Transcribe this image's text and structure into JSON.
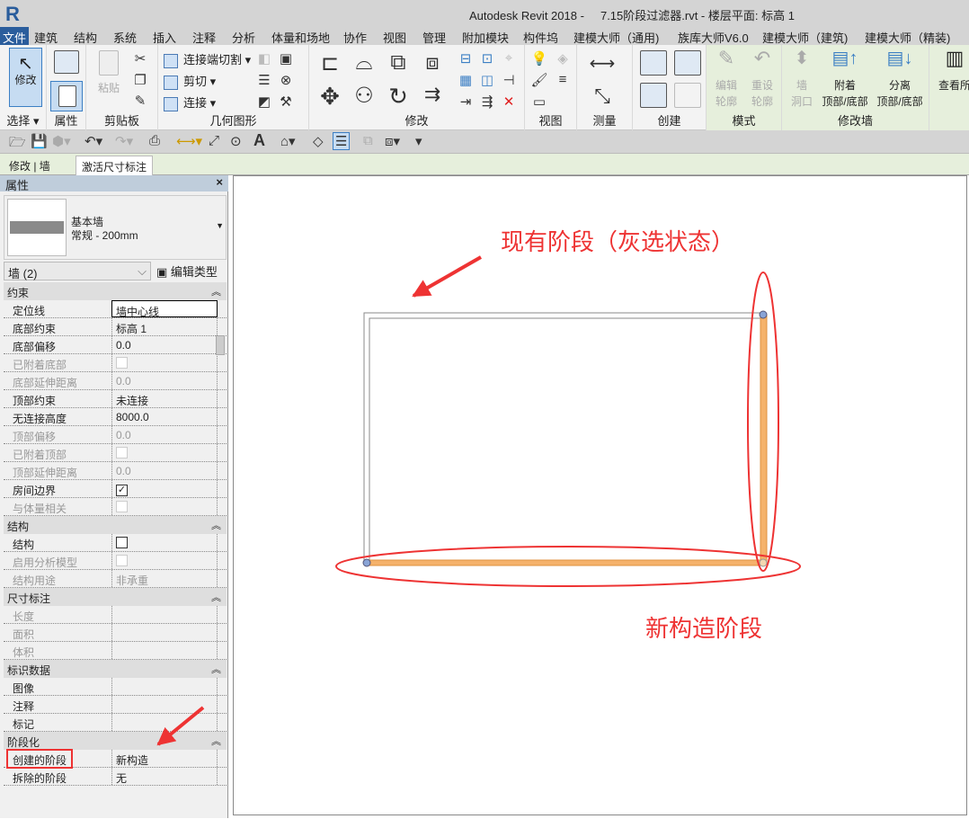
{
  "app": {
    "logo": "R",
    "title": "Autodesk Revit 2018 -     7.15阶段过滤器.rvt - 楼层平面: 标高 1"
  },
  "tabs": [
    "文件",
    "建筑",
    "结构",
    "系统",
    "插入",
    "注释",
    "分析",
    "体量和场地",
    "协作",
    "视图",
    "管理",
    "附加模块",
    "构件坞",
    "建模大师（通用)",
    "族库大师V6.0",
    "建模大师（建筑)",
    "建模大师（精装)"
  ],
  "ribbon": {
    "panels": [
      "选择",
      "属性",
      "剪贴板",
      "几何图形",
      "修改",
      "视图",
      "测量",
      "创建",
      "模式",
      "修改墙"
    ],
    "modify": "修改",
    "paste": "粘贴",
    "geometry": [
      "连接端切割",
      "剪切",
      "连接"
    ],
    "mode": [
      "编辑\n轮廓",
      "重设\n轮廓"
    ],
    "wall": [
      "墙\n洞口",
      "附着\n顶部/底部",
      "分离\n顶部/底部",
      "查看所"
    ]
  },
  "context": {
    "modify_tab": "修改 | 墙",
    "activate_dim": "激活尺寸标注"
  },
  "properties": {
    "title": "属性",
    "close": "×",
    "family": "基本墙",
    "type": "常规 - 200mm",
    "instance": "墙 (2)",
    "edit_type": "编辑类型",
    "groups": [
      {
        "name": "约束",
        "rows": [
          {
            "k": "定位线",
            "v": "墙中心线"
          },
          {
            "k": "底部约束",
            "v": "标高 1"
          },
          {
            "k": "底部偏移",
            "v": "0.0"
          },
          {
            "k": "已附着底部",
            "v": "",
            "cb": "dis"
          },
          {
            "k": "底部延伸距离",
            "v": "0.0",
            "dis": true
          },
          {
            "k": "顶部约束",
            "v": "未连接"
          },
          {
            "k": "无连接高度",
            "v": "8000.0"
          },
          {
            "k": "顶部偏移",
            "v": "0.0",
            "dis": true
          },
          {
            "k": "已附着顶部",
            "v": "",
            "cb": "dis"
          },
          {
            "k": "顶部延伸距离",
            "v": "0.0",
            "dis": true
          },
          {
            "k": "房间边界",
            "v": "",
            "cb": "on"
          },
          {
            "k": "与体量相关",
            "v": "",
            "cb": "dis"
          }
        ]
      },
      {
        "name": "结构",
        "rows": [
          {
            "k": "结构",
            "v": "",
            "cb": "off"
          },
          {
            "k": "启用分析模型",
            "v": "",
            "cb": "dis"
          },
          {
            "k": "结构用途",
            "v": "非承重",
            "dis": true
          }
        ]
      },
      {
        "name": "尺寸标注",
        "rows": [
          {
            "k": "长度",
            "v": "",
            "dis": true
          },
          {
            "k": "面积",
            "v": "",
            "dis": true
          },
          {
            "k": "体积",
            "v": "",
            "dis": true
          }
        ]
      },
      {
        "name": "标识数据",
        "rows": [
          {
            "k": "图像",
            "v": ""
          },
          {
            "k": "注释",
            "v": ""
          },
          {
            "k": "标记",
            "v": ""
          }
        ]
      },
      {
        "name": "阶段化",
        "rows": [
          {
            "k": "创建的阶段",
            "v": "新构造"
          },
          {
            "k": "拆除的阶段",
            "v": "无"
          }
        ]
      }
    ]
  },
  "annotations": {
    "existing": "现有阶段（灰选状态）",
    "new": "新构造阶段",
    "color": "#ee3333"
  },
  "colors": {
    "new_wall": "#f5b26b",
    "existing_wall": "#888888"
  }
}
